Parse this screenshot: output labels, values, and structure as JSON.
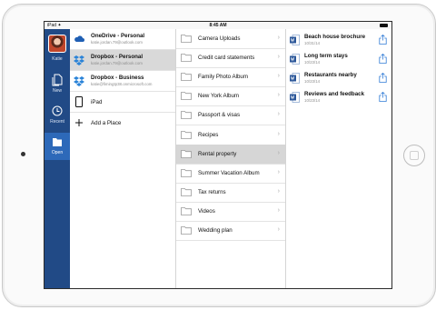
{
  "status": {
    "left": "iPad ✦",
    "time": "8:45 AM"
  },
  "rail": {
    "user_name": "Katie",
    "items": [
      {
        "label": "New",
        "icon": "new-document-icon"
      },
      {
        "label": "Recent",
        "icon": "clock-icon"
      },
      {
        "label": "Open",
        "icon": "folder-icon"
      }
    ]
  },
  "places": [
    {
      "title": "OneDrive - Personal",
      "subtitle": "katie.jordan.79@outlook.com",
      "icon": "onedrive-cloud-icon"
    },
    {
      "title": "Dropbox - Personal",
      "subtitle": "katie.jordan.79@outlook.com",
      "icon": "dropbox-icon"
    },
    {
      "title": "Dropbox - Business",
      "subtitle": "katie@fimingtp38.onmicrosoft.com",
      "icon": "dropbox-icon"
    },
    {
      "title": "iPad",
      "icon": "ipad-icon"
    },
    {
      "title": "Add a Place",
      "icon": "plus-icon"
    }
  ],
  "folders": [
    "Camera Uploads",
    "Credit card statements",
    "Family Photo Album",
    "New York Album",
    "Passport & visas",
    "Recipes",
    "Rental property",
    "Summer Vacation Album",
    "Tax returns",
    "Videos",
    "Wedding plan"
  ],
  "files": [
    {
      "name": "Beach house brochure",
      "date": "10/31/14"
    },
    {
      "name": "Long term stays",
      "date": "10/23/14"
    },
    {
      "name": "Restaurants nearby",
      "date": "10/23/14"
    },
    {
      "name": "Reviews and feedback",
      "date": "10/23/14"
    }
  ],
  "colors": {
    "rail": "#214a86",
    "rail_active": "#2d69b9",
    "word_blue": "#2a5699",
    "accent": "#2f7bd6"
  }
}
